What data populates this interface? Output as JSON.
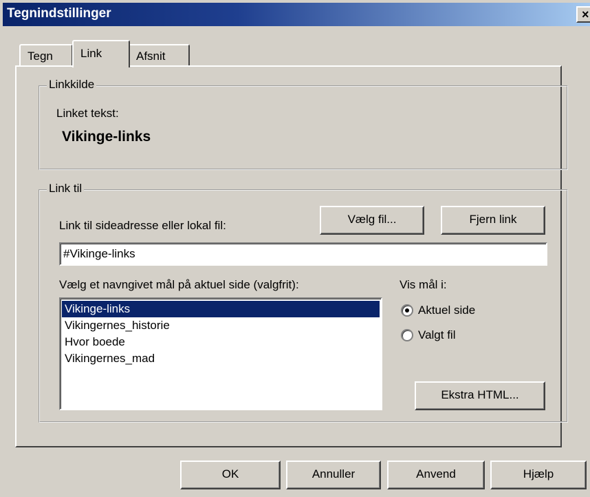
{
  "window": {
    "title": "Tegnindstillinger",
    "close_glyph": "×"
  },
  "tabs": [
    {
      "label": "Tegn",
      "active": false
    },
    {
      "label": "Link",
      "active": true
    },
    {
      "label": "Afsnit",
      "active": false
    }
  ],
  "linkkilde": {
    "legend": "Linkkilde",
    "linked_text_label": "Linket tekst:",
    "linked_text_value": "Vikinge-links"
  },
  "link_til": {
    "legend": "Link til",
    "address_label": "Link til sideadresse eller lokal fil:",
    "choose_file_button": "Vælg fil...",
    "remove_link_button": "Fjern link",
    "address_value": "#Vikinge-links",
    "targets_label": "Vælg et navngivet mål på aktuel side (valgfrit):",
    "targets": [
      "Vikinge-links",
      "Vikingernes_historie",
      "Hvor boede",
      "Vikingernes_mad"
    ],
    "selected_target": "Vikinge-links",
    "show_target_label": "Vis mål i:",
    "radio_current": "Aktuel side",
    "radio_chosen": "Valgt fil",
    "radio_selected": "Aktuel side",
    "extra_html_button": "Ekstra HTML..."
  },
  "footer": {
    "ok": "OK",
    "cancel": "Annuller",
    "apply": "Anvend",
    "help": "Hjælp"
  }
}
